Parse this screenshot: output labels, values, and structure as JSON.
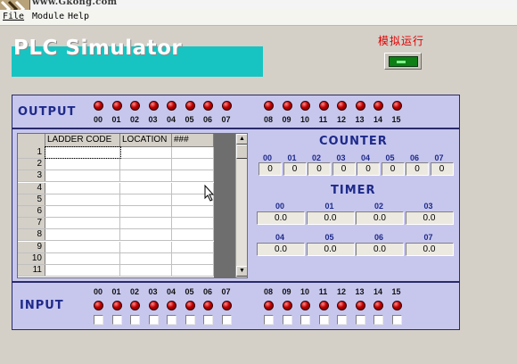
{
  "window": {
    "title_url": "www.Gkong.com"
  },
  "menu": [
    "File",
    "Module",
    "Help"
  ],
  "banner": {
    "title": "PLC Simulator"
  },
  "simulation": {
    "label": "模拟运行"
  },
  "output": {
    "title": "OUTPUT",
    "group1": [
      "00",
      "01",
      "02",
      "03",
      "04",
      "05",
      "06",
      "07"
    ],
    "group2": [
      "08",
      "09",
      "10",
      "11",
      "12",
      "13",
      "14",
      "15"
    ]
  },
  "input": {
    "title": "INPUT",
    "group1": [
      "00",
      "01",
      "02",
      "03",
      "04",
      "05",
      "06",
      "07"
    ],
    "group2": [
      "08",
      "09",
      "10",
      "11",
      "12",
      "13",
      "14",
      "15"
    ]
  },
  "grid": {
    "columns": [
      "LADDER CODE",
      "LOCATION",
      "###"
    ],
    "rows": [
      "1",
      "2",
      "3",
      "4",
      "5",
      "6",
      "7",
      "8",
      "9",
      "10",
      "11"
    ]
  },
  "counter": {
    "title": "COUNTER",
    "labels": [
      "00",
      "01",
      "02",
      "03",
      "04",
      "05",
      "06",
      "07"
    ],
    "values": [
      "0",
      "0",
      "0",
      "0",
      "0",
      "0",
      "0",
      "0"
    ]
  },
  "timer": {
    "title": "TIMER",
    "labels": [
      "00",
      "01",
      "02",
      "03",
      "04",
      "05",
      "06",
      "07"
    ],
    "values": [
      "0.0",
      "0.0",
      "0.0",
      "0.0",
      "0.0",
      "0.0",
      "0.0",
      "0.0"
    ]
  },
  "colors": {
    "banner": "#17c4c1",
    "panel": "#c7c7ee",
    "title": "#1e2a8a",
    "led": "#c30000",
    "sim_label": "#e00000"
  }
}
